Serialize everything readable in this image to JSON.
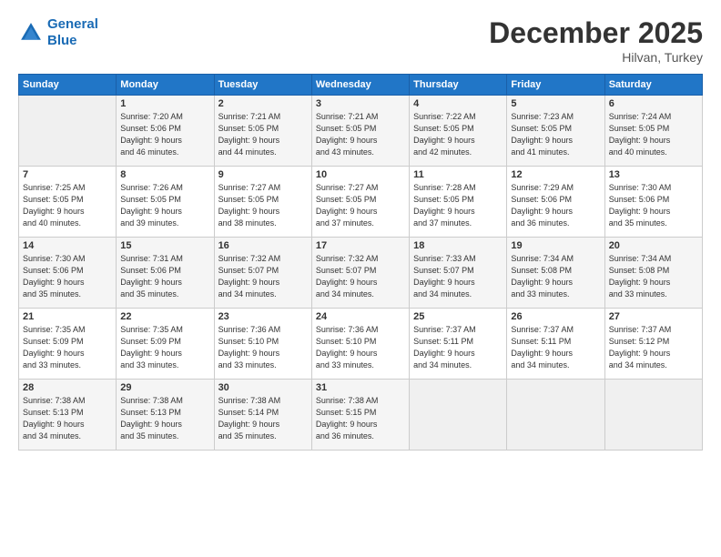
{
  "logo": {
    "line1": "General",
    "line2": "Blue"
  },
  "title": "December 2025",
  "subtitle": "Hilvan, Turkey",
  "header_days": [
    "Sunday",
    "Monday",
    "Tuesday",
    "Wednesday",
    "Thursday",
    "Friday",
    "Saturday"
  ],
  "weeks": [
    [
      {
        "day": "",
        "content": ""
      },
      {
        "day": "1",
        "content": "Sunrise: 7:20 AM\nSunset: 5:06 PM\nDaylight: 9 hours\nand 46 minutes."
      },
      {
        "day": "2",
        "content": "Sunrise: 7:21 AM\nSunset: 5:05 PM\nDaylight: 9 hours\nand 44 minutes."
      },
      {
        "day": "3",
        "content": "Sunrise: 7:21 AM\nSunset: 5:05 PM\nDaylight: 9 hours\nand 43 minutes."
      },
      {
        "day": "4",
        "content": "Sunrise: 7:22 AM\nSunset: 5:05 PM\nDaylight: 9 hours\nand 42 minutes."
      },
      {
        "day": "5",
        "content": "Sunrise: 7:23 AM\nSunset: 5:05 PM\nDaylight: 9 hours\nand 41 minutes."
      },
      {
        "day": "6",
        "content": "Sunrise: 7:24 AM\nSunset: 5:05 PM\nDaylight: 9 hours\nand 40 minutes."
      }
    ],
    [
      {
        "day": "7",
        "content": "Sunrise: 7:25 AM\nSunset: 5:05 PM\nDaylight: 9 hours\nand 40 minutes."
      },
      {
        "day": "8",
        "content": "Sunrise: 7:26 AM\nSunset: 5:05 PM\nDaylight: 9 hours\nand 39 minutes."
      },
      {
        "day": "9",
        "content": "Sunrise: 7:27 AM\nSunset: 5:05 PM\nDaylight: 9 hours\nand 38 minutes."
      },
      {
        "day": "10",
        "content": "Sunrise: 7:27 AM\nSunset: 5:05 PM\nDaylight: 9 hours\nand 37 minutes."
      },
      {
        "day": "11",
        "content": "Sunrise: 7:28 AM\nSunset: 5:05 PM\nDaylight: 9 hours\nand 37 minutes."
      },
      {
        "day": "12",
        "content": "Sunrise: 7:29 AM\nSunset: 5:06 PM\nDaylight: 9 hours\nand 36 minutes."
      },
      {
        "day": "13",
        "content": "Sunrise: 7:30 AM\nSunset: 5:06 PM\nDaylight: 9 hours\nand 35 minutes."
      }
    ],
    [
      {
        "day": "14",
        "content": "Sunrise: 7:30 AM\nSunset: 5:06 PM\nDaylight: 9 hours\nand 35 minutes."
      },
      {
        "day": "15",
        "content": "Sunrise: 7:31 AM\nSunset: 5:06 PM\nDaylight: 9 hours\nand 35 minutes."
      },
      {
        "day": "16",
        "content": "Sunrise: 7:32 AM\nSunset: 5:07 PM\nDaylight: 9 hours\nand 34 minutes."
      },
      {
        "day": "17",
        "content": "Sunrise: 7:32 AM\nSunset: 5:07 PM\nDaylight: 9 hours\nand 34 minutes."
      },
      {
        "day": "18",
        "content": "Sunrise: 7:33 AM\nSunset: 5:07 PM\nDaylight: 9 hours\nand 34 minutes."
      },
      {
        "day": "19",
        "content": "Sunrise: 7:34 AM\nSunset: 5:08 PM\nDaylight: 9 hours\nand 33 minutes."
      },
      {
        "day": "20",
        "content": "Sunrise: 7:34 AM\nSunset: 5:08 PM\nDaylight: 9 hours\nand 33 minutes."
      }
    ],
    [
      {
        "day": "21",
        "content": "Sunrise: 7:35 AM\nSunset: 5:09 PM\nDaylight: 9 hours\nand 33 minutes."
      },
      {
        "day": "22",
        "content": "Sunrise: 7:35 AM\nSunset: 5:09 PM\nDaylight: 9 hours\nand 33 minutes."
      },
      {
        "day": "23",
        "content": "Sunrise: 7:36 AM\nSunset: 5:10 PM\nDaylight: 9 hours\nand 33 minutes."
      },
      {
        "day": "24",
        "content": "Sunrise: 7:36 AM\nSunset: 5:10 PM\nDaylight: 9 hours\nand 33 minutes."
      },
      {
        "day": "25",
        "content": "Sunrise: 7:37 AM\nSunset: 5:11 PM\nDaylight: 9 hours\nand 34 minutes."
      },
      {
        "day": "26",
        "content": "Sunrise: 7:37 AM\nSunset: 5:11 PM\nDaylight: 9 hours\nand 34 minutes."
      },
      {
        "day": "27",
        "content": "Sunrise: 7:37 AM\nSunset: 5:12 PM\nDaylight: 9 hours\nand 34 minutes."
      }
    ],
    [
      {
        "day": "28",
        "content": "Sunrise: 7:38 AM\nSunset: 5:13 PM\nDaylight: 9 hours\nand 34 minutes."
      },
      {
        "day": "29",
        "content": "Sunrise: 7:38 AM\nSunset: 5:13 PM\nDaylight: 9 hours\nand 35 minutes."
      },
      {
        "day": "30",
        "content": "Sunrise: 7:38 AM\nSunset: 5:14 PM\nDaylight: 9 hours\nand 35 minutes."
      },
      {
        "day": "31",
        "content": "Sunrise: 7:38 AM\nSunset: 5:15 PM\nDaylight: 9 hours\nand 36 minutes."
      },
      {
        "day": "",
        "content": ""
      },
      {
        "day": "",
        "content": ""
      },
      {
        "day": "",
        "content": ""
      }
    ]
  ]
}
